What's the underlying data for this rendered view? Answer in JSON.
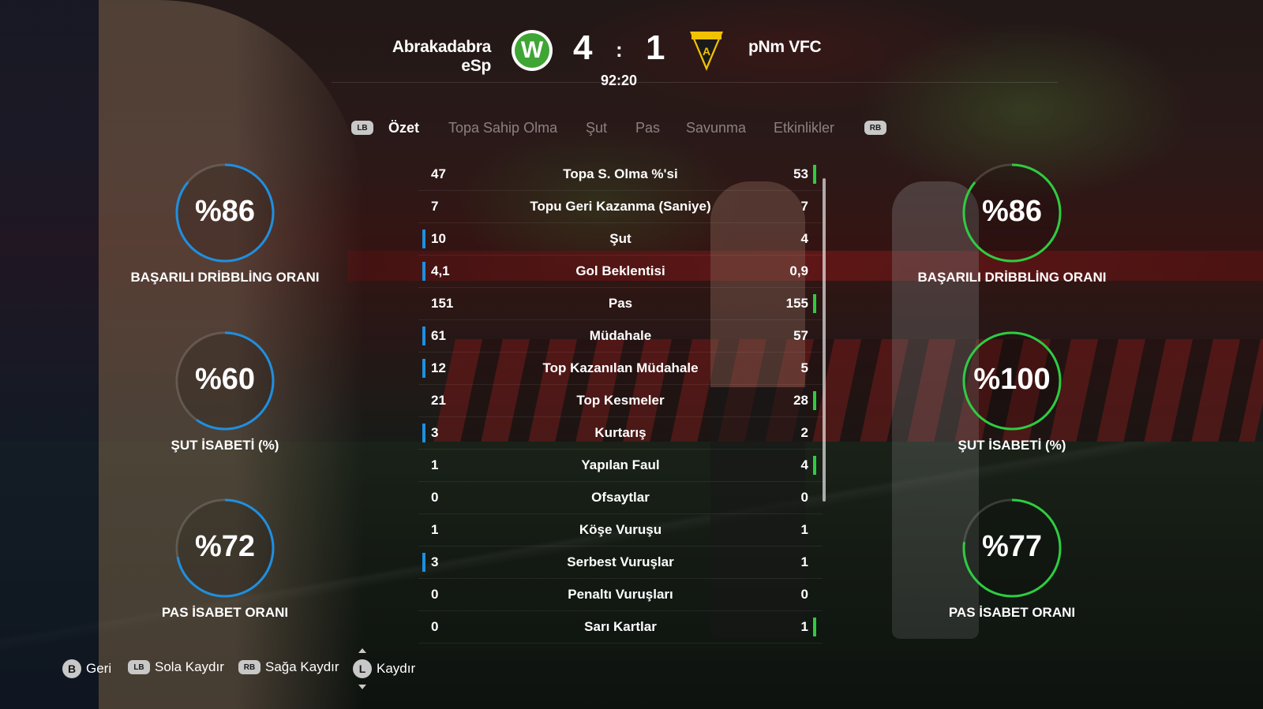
{
  "match": {
    "home_team": "Abrakadabra eSp",
    "away_team": "pNm VFC",
    "home_score": "4",
    "away_score": "1",
    "separator": ":",
    "clock": "92:20"
  },
  "tabs": {
    "prev_button": "LB",
    "next_button": "RB",
    "items": [
      "Özet",
      "Topa Sahip Olma",
      "Şut",
      "Pas",
      "Savunma",
      "Etkinlikler"
    ],
    "active": "Özet"
  },
  "stats": [
    {
      "label": "Topa S. Olma %'si",
      "home": "47",
      "away": "53",
      "leader": "away"
    },
    {
      "label": "Topu Geri Kazanma (Saniye)",
      "home": "7",
      "away": "7",
      "leader": "none"
    },
    {
      "label": "Şut",
      "home": "10",
      "away": "4",
      "leader": "home"
    },
    {
      "label": "Gol Beklentisi",
      "home": "4,1",
      "away": "0,9",
      "leader": "home"
    },
    {
      "label": "Pas",
      "home": "151",
      "away": "155",
      "leader": "away"
    },
    {
      "label": "Müdahale",
      "home": "61",
      "away": "57",
      "leader": "home"
    },
    {
      "label": "Top Kazanılan Müdahale",
      "home": "12",
      "away": "5",
      "leader": "home"
    },
    {
      "label": "Top Kesmeler",
      "home": "21",
      "away": "28",
      "leader": "away"
    },
    {
      "label": "Kurtarış",
      "home": "3",
      "away": "2",
      "leader": "home"
    },
    {
      "label": "Yapılan Faul",
      "home": "1",
      "away": "4",
      "leader": "away"
    },
    {
      "label": "Ofsaytlar",
      "home": "0",
      "away": "0",
      "leader": "none"
    },
    {
      "label": "Köşe Vuruşu",
      "home": "1",
      "away": "1",
      "leader": "none"
    },
    {
      "label": "Serbest Vuruşlar",
      "home": "3",
      "away": "1",
      "leader": "home"
    },
    {
      "label": "Penaltı Vuruşları",
      "home": "0",
      "away": "0",
      "leader": "none"
    },
    {
      "label": "Sarı Kartlar",
      "home": "0",
      "away": "1",
      "leader": "away"
    }
  ],
  "home_rings": [
    {
      "value": "%86",
      "pct": 86,
      "label": "BAŞARILI DRİBBLİNG ORANI"
    },
    {
      "value": "%60",
      "pct": 60,
      "label": "ŞUT İSABETİ (%)"
    },
    {
      "value": "%72",
      "pct": 72,
      "label": "PAS İSABET ORANI"
    }
  ],
  "away_rings": [
    {
      "value": "%86",
      "pct": 86,
      "label": "BAŞARILI DRİBBLİNG ORANI"
    },
    {
      "value": "%100",
      "pct": 100,
      "label": "ŞUT İSABETİ (%)"
    },
    {
      "value": "%77",
      "pct": 77,
      "label": "PAS İSABET ORANI"
    }
  ],
  "colors": {
    "home": "#1e8fe0",
    "away": "#2ecc40"
  },
  "footer": [
    {
      "button": "B",
      "label": "Geri",
      "style": "circle"
    },
    {
      "button": "LB",
      "label": "Sola Kaydır",
      "style": "pill"
    },
    {
      "button": "RB",
      "label": "Sağa Kaydır",
      "style": "pill"
    },
    {
      "button": "L",
      "label": "Kaydır",
      "style": "stick"
    }
  ]
}
